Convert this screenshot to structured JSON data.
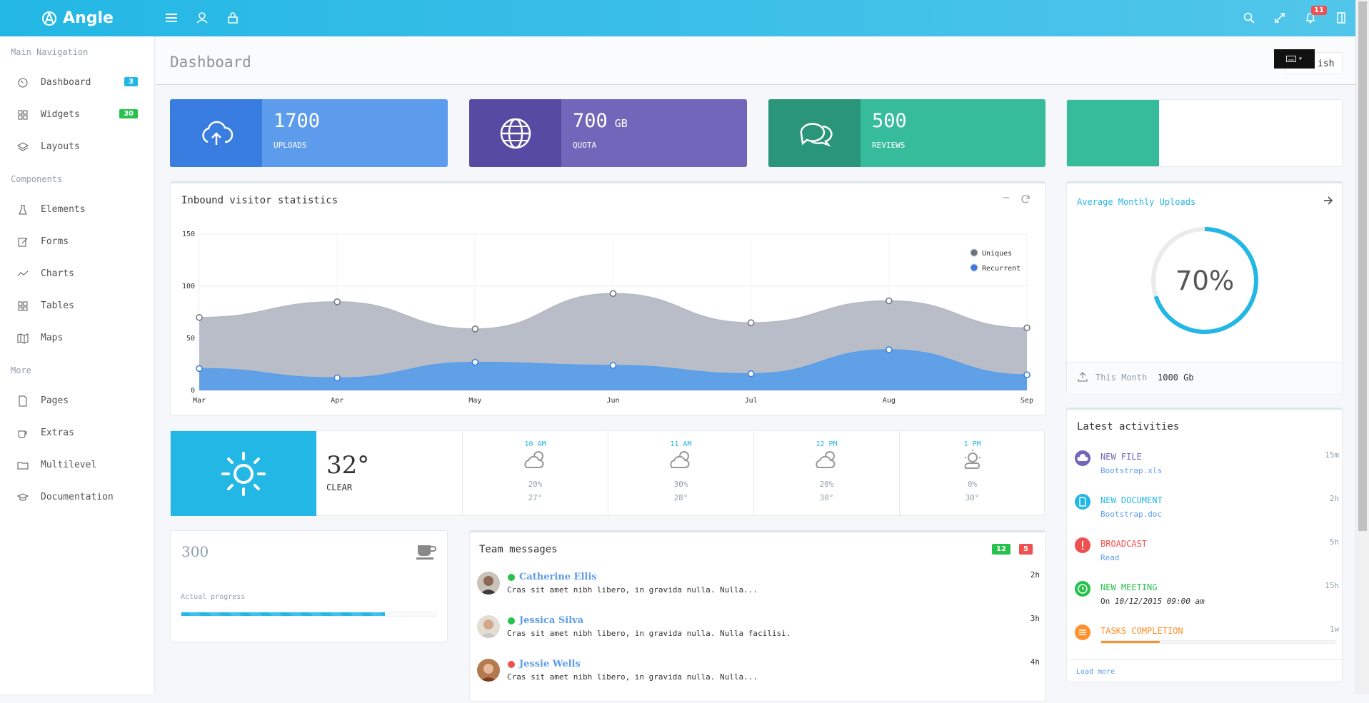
{
  "app": {
    "brand": "Angle"
  },
  "topbar": {
    "notification_count": "11"
  },
  "sidebar": {
    "headings": [
      "Main Navigation",
      "Components",
      "More"
    ],
    "items": [
      {
        "label": "Dashboard",
        "icon": "speedometer-icon",
        "badge": "3",
        "badge_color": "#23b7e5"
      },
      {
        "label": "Widgets",
        "icon": "grid-icon",
        "badge": "30",
        "badge_color": "#27c24c"
      },
      {
        "label": "Layouts",
        "icon": "layers-icon"
      },
      {
        "label": "Elements",
        "icon": "chemistry-icon"
      },
      {
        "label": "Forms",
        "icon": "note-icon"
      },
      {
        "label": "Charts",
        "icon": "graph-icon"
      },
      {
        "label": "Tables",
        "icon": "grid-icon"
      },
      {
        "label": "Maps",
        "icon": "map-icon"
      },
      {
        "label": "Pages",
        "icon": "doc-icon"
      },
      {
        "label": "Extras",
        "icon": "cup-icon"
      },
      {
        "label": "Multilevel",
        "icon": "folder-icon"
      },
      {
        "label": "Documentation",
        "icon": "graduation-icon"
      }
    ]
  },
  "header": {
    "title": "Dashboard",
    "language_button": "English",
    "language_button_visible_suffix": "ish"
  },
  "stats": [
    {
      "value": "1700",
      "unit": "",
      "label": "UPLOADS",
      "icon": "cloud-upload-icon",
      "color_dark": "#3a7de0",
      "color_light": "#5d9cec"
    },
    {
      "value": "700",
      "unit": "GB",
      "label": "QUOTA",
      "icon": "globe-icon",
      "color_dark": "#564aa3",
      "color_light": "#7266ba"
    },
    {
      "value": "500",
      "unit": "",
      "label": "REVIEWS",
      "icon": "bubbles-icon",
      "color_dark": "#2b957a",
      "color_light": "#37bc9b"
    },
    {
      "value": "",
      "label": "",
      "color_dark": "#37bc9b",
      "color_light": "#ffffff"
    }
  ],
  "visitor_chart": {
    "title": "Inbound visitor statistics",
    "chart_data": {
      "type": "area",
      "categories": [
        "Mar",
        "Apr",
        "May",
        "Jun",
        "Jul",
        "Aug",
        "Sep"
      ],
      "series": [
        {
          "name": "Uniques",
          "values": [
            70,
            85,
            59,
            93,
            65,
            86,
            60
          ],
          "color": "#b4b9c5"
        },
        {
          "name": "Recurrent",
          "values": [
            21,
            12,
            27,
            24,
            16,
            39,
            15
          ],
          "color": "#5b9ee8"
        }
      ],
      "ylim": [
        0,
        150
      ],
      "yticks": [
        0,
        50,
        100,
        150
      ],
      "grid": true,
      "legend_position": "top-right"
    }
  },
  "average_uploads": {
    "title": "Average Monthly Uploads",
    "percent": "70%",
    "percent_value": 70,
    "footer_label": "This Month",
    "footer_value": "1000 Gb"
  },
  "weather": {
    "now": {
      "temp": "32°",
      "condition": "CLEAR"
    },
    "hours": [
      {
        "time": "10 AM",
        "pct": "20%",
        "temp": "27°"
      },
      {
        "time": "11 AM",
        "pct": "30%",
        "temp": "28°"
      },
      {
        "time": "12 PM",
        "pct": "20%",
        "temp": "30°"
      },
      {
        "time": "1 PM",
        "pct": "0%",
        "temp": "30°"
      }
    ]
  },
  "progress_widget": {
    "value": "300",
    "label": "Actual progress",
    "progress": 80
  },
  "team_messages": {
    "title": "Team messages",
    "badges": [
      "12",
      "5"
    ],
    "messages": [
      {
        "name": "Catherine Ellis",
        "text": "Cras sit amet nibh libero, in gravida nulla. Nulla...",
        "time": "2h",
        "status_color": "#27c24c"
      },
      {
        "name": "Jessica Silva",
        "text": "Cras sit amet nibh libero, in gravida nulla. Nulla facilisi.",
        "time": "3h",
        "status_color": "#27c24c"
      },
      {
        "name": "Jessie Wells",
        "text": "Cras sit amet nibh libero, in gravida nulla. Nulla...",
        "time": "4h",
        "status_color": "#f05050"
      }
    ]
  },
  "activities": {
    "title": "Latest activities",
    "items": [
      {
        "title": "NEW FILE",
        "sub": "Bootstrap.xls",
        "time": "15m",
        "color": "#7266ba"
      },
      {
        "title": "NEW DOCUMENT",
        "sub": "Bootstrap.doc",
        "time": "2h",
        "color": "#23b7e5"
      },
      {
        "title": "BROADCAST",
        "sub": "Read",
        "time": "5h",
        "color": "#f05050"
      },
      {
        "title": "NEW MEETING",
        "sub_prefix": "On ",
        "sub": "10/12/2015 09:00 am",
        "time": "15h",
        "color": "#27c24c"
      },
      {
        "title": "TASKS COMPLETION",
        "time": "1w",
        "color": "#ff902b",
        "progress": 25
      }
    ],
    "load_more": "Load more"
  }
}
